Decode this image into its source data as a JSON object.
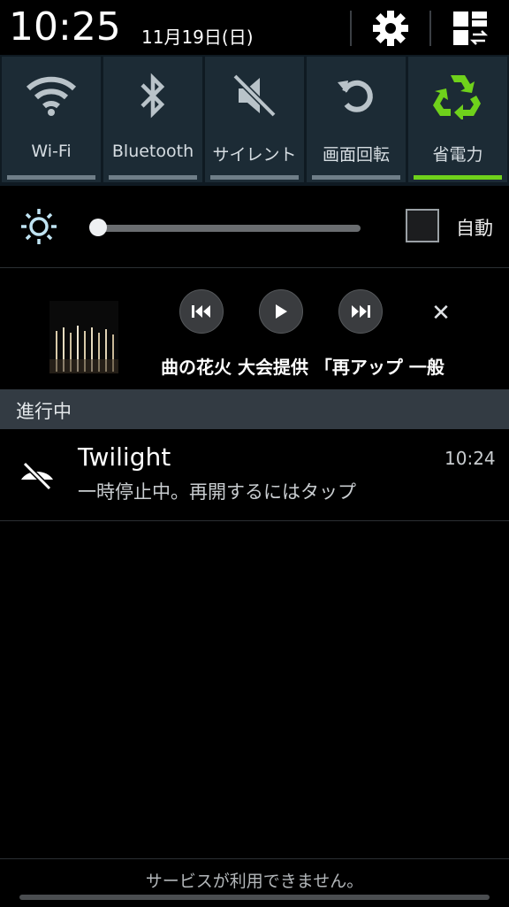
{
  "header": {
    "time": "10:25",
    "date": "11月19日(日)",
    "settings_icon": "gear-icon",
    "layout_icon": "grid-toggle-icon"
  },
  "quick_settings": [
    {
      "label": "Wi-Fi",
      "icon": "wifi-icon",
      "active": false
    },
    {
      "label": "Bluetooth",
      "icon": "bluetooth-icon",
      "active": false
    },
    {
      "label": "サイレント",
      "icon": "sound-off-icon",
      "active": false
    },
    {
      "label": "画面回転",
      "icon": "rotate-icon",
      "active": false
    },
    {
      "label": "省電力",
      "icon": "recycle-icon",
      "active": true
    }
  ],
  "brightness": {
    "level": 0.03,
    "auto_label": "自動",
    "auto_checked": false
  },
  "media": {
    "ticker": "曲の花火 大会提供 「再アップ 一般",
    "close_label": "✕"
  },
  "section": {
    "title": "進行中"
  },
  "notification": {
    "title": "Twilight",
    "text": "一時停止中。再開するにはタップ",
    "time": "10:24",
    "icon": "eye-off-icon"
  },
  "footer": {
    "text": "サービスが利用できません。"
  },
  "colors": {
    "accent_green": "#6fd11b",
    "tile_bg": "#1c2b35",
    "section_bg": "#333b43"
  }
}
